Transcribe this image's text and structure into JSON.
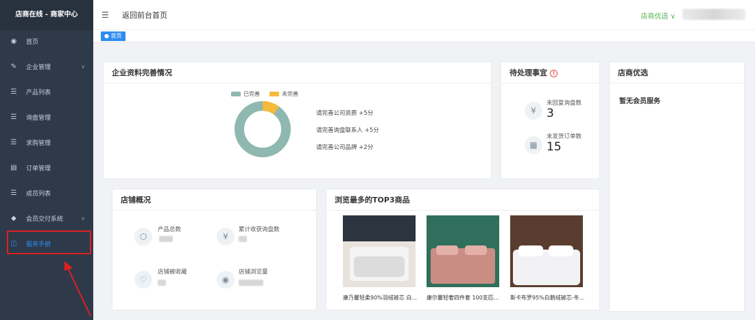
{
  "sidebar": {
    "title": "店商在线 - 商家中心",
    "items": [
      {
        "label": "首页",
        "icon": "dashboard-icon"
      },
      {
        "label": "企业管理",
        "icon": "edit-icon"
      },
      {
        "label": "产品列表",
        "icon": "list-icon"
      },
      {
        "label": "询盘管理",
        "icon": "list-icon"
      },
      {
        "label": "求购管理",
        "icon": "list-icon"
      },
      {
        "label": "订单管理",
        "icon": "document-icon"
      },
      {
        "label": "成员列表",
        "icon": "list-icon"
      },
      {
        "label": "会员交付系统",
        "icon": "diamond-icon"
      },
      {
        "label": "服务手册",
        "icon": "book-icon"
      }
    ]
  },
  "header": {
    "back_label": "返回前台首页",
    "store_select": "店商优选 ∨"
  },
  "tabs": [
    {
      "label": "● 首页"
    }
  ],
  "profile_card": {
    "title": "企业资料完善情况",
    "legend": [
      {
        "label": "已完善",
        "color": "#8fb8b0"
      },
      {
        "label": "未完善",
        "color": "#f5b93b"
      }
    ],
    "completion": {
      "done": 90,
      "undone": 10
    },
    "tips": [
      "请完善公司资质 +5分",
      "请完善询盘联系人 +5分",
      "请完善公司品牌 +2分"
    ]
  },
  "todo_card": {
    "title": "待处理事宜",
    "items": [
      {
        "label": "未回复询盘数",
        "value": "3",
        "icon": "inquiry-icon"
      },
      {
        "label": "未发货订单数",
        "value": "15",
        "icon": "order-icon"
      }
    ]
  },
  "preferred_card": {
    "title": "店商优选",
    "empty_text": "暂无会员服务"
  },
  "shop_card": {
    "title": "店铺概况",
    "stats": [
      {
        "label": "产品总数",
        "icon": "box-icon"
      },
      {
        "label": "累计收获询盘数",
        "icon": "inquiry-icon"
      },
      {
        "label": "店铺被收藏",
        "icon": "heart-icon"
      },
      {
        "label": "店铺浏览量",
        "icon": "eye-icon"
      }
    ]
  },
  "top3_card": {
    "title": "浏览最多的TOP3商品",
    "products": [
      {
        "name": "康乃馨轻柔90%羽绒被芯 白...",
        "bg": "#e7e3dc",
        "band": "#2c3440"
      },
      {
        "name": "康尔馨轻奢四件套 100支匹...",
        "bg": "#2f6f5c",
        "band": "#2f6f5c"
      },
      {
        "name": "斯卡布罗95%白鹅绒被芯-冬...",
        "bg": "#5a3d2e",
        "band": "#5a3d2e"
      }
    ]
  }
}
